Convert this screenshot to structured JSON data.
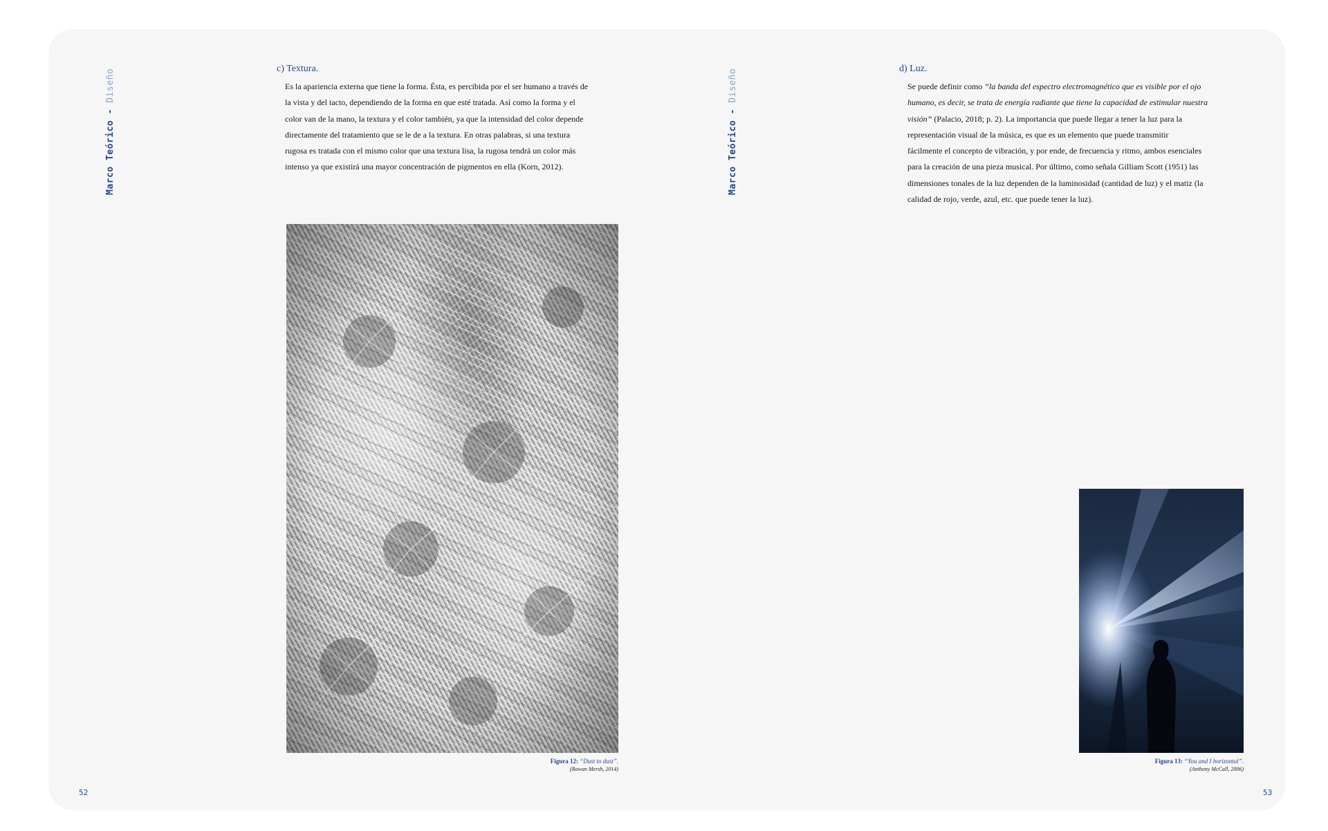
{
  "running_head": {
    "section": "Marco Teórico",
    "separator": "-",
    "subsection": "Diseño"
  },
  "left_page": {
    "heading": "c) Textura.",
    "paragraph_lines": [
      "Es la apariencia externa que tiene la forma. Ésta, es percibida por el ser  humano a través de",
      "la vista y del tacto, dependiendo de la forma en que  esté tratada. Así como la forma y el",
      "color van de la mano, la textura y el color también, ya que la intensidad del color depende",
      "directamente del tratamiento que se le de a la textura. En otras palabras, si una textura",
      "rugosa es tratada con el mismo color que una textura lisa, la rugosa tendrá  un color más",
      "intenso ya que existirá una mayor concentración de  pigmentos en ella (Korn, 2012)."
    ],
    "figure": {
      "label": "Figura 12:",
      "title": "“Dust to dust”.",
      "credit": "(Rowan Mersh, 2014)",
      "image": "texture-photo"
    },
    "folio": "52"
  },
  "right_page": {
    "heading": "d) Luz.",
    "paragraph": {
      "line1_plain": "Se puede definir como ",
      "line1_italic": "“la banda del espectro electromagnético que es visible por el ojo",
      "line2_italic": " humano, es decir, se trata de energía radiante que tiene la capacidad de estimular nuestra",
      "line3_italic": "visión”",
      "line3_plain": " (Palacio, 2018; p. 2).  La importancia que puede llegar a tener la luz para la",
      "lines_plain": [
        "representación  visual de la música, es que es un elemento que puede transmitir",
        "fácilmente el concepto de vibración, y por ende, de frecuencia y ritmo, ambos esenciales",
        "para la creación de una pieza musical. Por último, como señala Gilliam Scott (1951) las",
        "dimensiones tonales de la luz dependen de la luminosidad (cantidad de luz) y el matiz (la",
        "calidad de rojo, verde, azul, etc. que puede tener la luz)."
      ]
    },
    "figure": {
      "label": "Figura 13:",
      "title": "“You and I horizontal”.",
      "credit": "(Anthony McCall, 2006)",
      "image": "light-installation-photo"
    },
    "folio": "53"
  },
  "colors": {
    "accent_blue": "#27468a",
    "light_blue": "#8ea1c9",
    "page_bg": "#f6f6f6"
  }
}
